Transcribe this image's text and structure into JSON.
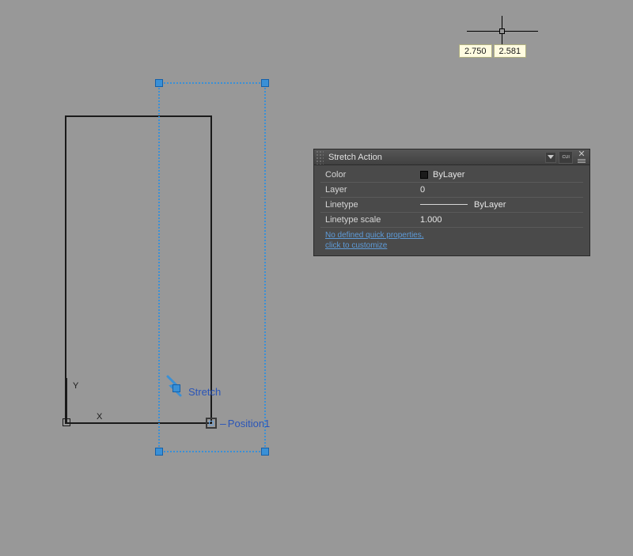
{
  "cursor": {
    "x": "2.750",
    "y": "2.581"
  },
  "drawing": {
    "stretch_label": "Stretch",
    "position_label": "Position1",
    "ucs_x": "X",
    "ucs_y": "Y"
  },
  "panel": {
    "title": "Stretch Action",
    "cui_label": "CUI",
    "rows": {
      "color_key": "Color",
      "color_val": "ByLayer",
      "layer_key": "Layer",
      "layer_val": "0",
      "linetype_key": "Linetype",
      "linetype_val": "ByLayer",
      "ltscale_key": "Linetype scale",
      "ltscale_val": "1.000"
    },
    "link1": "No defined quick properties,",
    "link2": "click to customize"
  }
}
